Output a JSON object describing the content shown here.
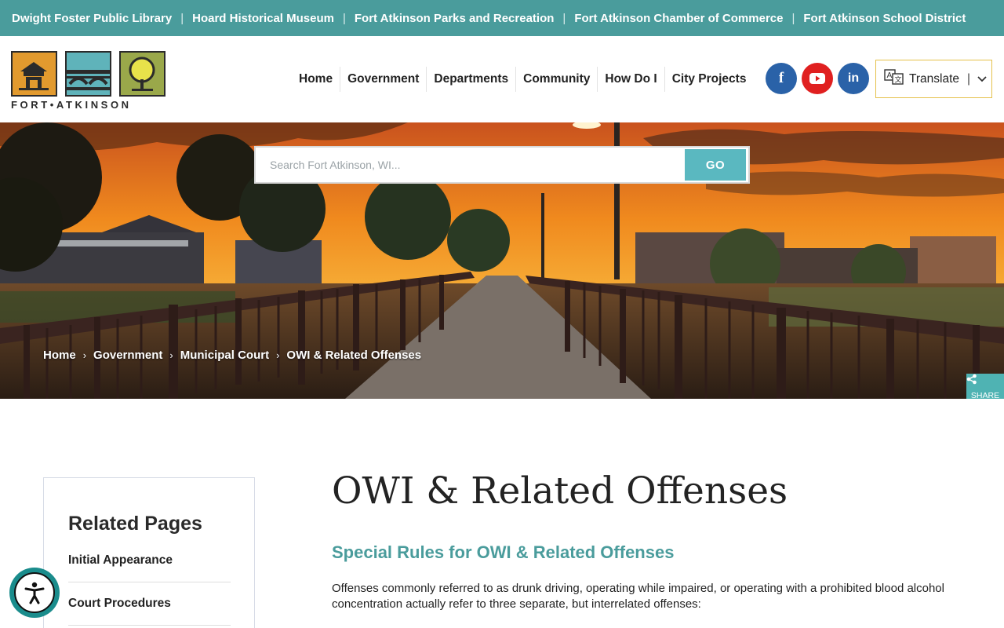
{
  "topbar": {
    "links": [
      "Dwight Foster Public Library",
      "Hoard Historical Museum",
      "Fort Atkinson Parks and Recreation",
      "Fort Atkinson Chamber of Commerce",
      "Fort Atkinson School District"
    ],
    "color": "#4a9c9c"
  },
  "logo": {
    "wordmark": "FORT•ATKINSON"
  },
  "nav": {
    "items": [
      "Home",
      "Government",
      "Departments",
      "Community",
      "How Do I",
      "City Projects"
    ]
  },
  "social": {
    "facebook": {
      "glyph": "f",
      "color": "#2a62a8"
    },
    "youtube": {
      "icon": "youtube-icon",
      "color": "#e02020"
    },
    "linkedin": {
      "glyph": "in",
      "color": "#2a62a8"
    }
  },
  "translate": {
    "label": "Translate"
  },
  "search": {
    "placeholder": "Search Fort Atkinson, WI...",
    "button": "GO"
  },
  "breadcrumb": [
    "Home",
    "Government",
    "Municipal Court",
    "OWI & Related Offenses"
  ],
  "share": {
    "label": "SHARE"
  },
  "sidebar": {
    "title": "Related Pages",
    "links": [
      "Initial Appearance",
      "Court Procedures"
    ]
  },
  "page": {
    "title": "OWI & Related Offenses",
    "subtitle": "Special Rules for OWI & Related Offenses",
    "paragraph": "Offenses commonly referred to as drunk driving, operating while impaired, or operating with a prohibited blood alcohol concentration actually refer to three separate, but interrelated offenses:",
    "accent_color": "#4a9c9c"
  },
  "accessibility": {
    "icon": "accessibility-icon"
  }
}
